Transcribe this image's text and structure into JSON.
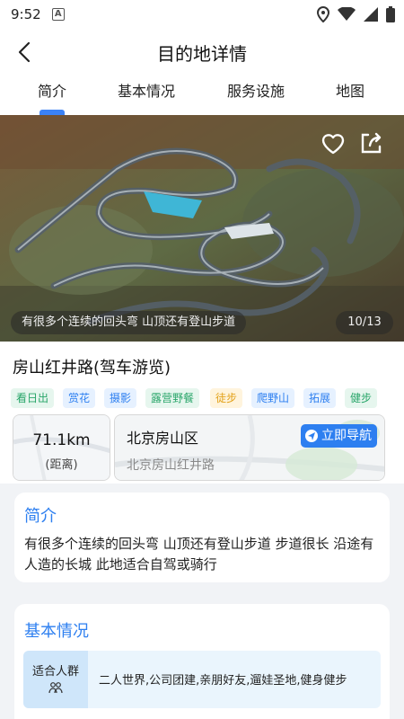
{
  "status_bar": {
    "time": "9:52",
    "badge": "A"
  },
  "header": {
    "title": "目的地详情"
  },
  "tabs": [
    {
      "label": "简介",
      "active": true
    },
    {
      "label": "基本情况",
      "active": false
    },
    {
      "label": "服务设施",
      "active": false
    },
    {
      "label": "地图",
      "active": false
    }
  ],
  "hero": {
    "caption": "有很多个连续的回头弯 山顶还有登山步道",
    "counter": "10/13",
    "icons": [
      "heart-outline-icon",
      "share-icon"
    ]
  },
  "place": {
    "name": "房山红井路(驾车游览)"
  },
  "tags": [
    {
      "label": "看日出",
      "color": "green"
    },
    {
      "label": "赏花",
      "color": "blue"
    },
    {
      "label": "摄影",
      "color": "blue"
    },
    {
      "label": "露营野餐",
      "color": "green"
    },
    {
      "label": "徒步",
      "color": "orange"
    },
    {
      "label": "爬野山",
      "color": "blue"
    },
    {
      "label": "拓展",
      "color": "blue"
    },
    {
      "label": "健步",
      "color": "green"
    }
  ],
  "distance": {
    "value": "71.1km",
    "label": "(距离)"
  },
  "location": {
    "city": "北京房山区",
    "address": "北京房山红井路",
    "navigate_label": "立即导航"
  },
  "intro": {
    "title": "简介",
    "text": "有很多个连续的回头弯 山顶还有登山步道 步道很长 沿途有人造的长城 此地适合自驾或骑行"
  },
  "basic": {
    "title": "基本情况",
    "rows": [
      {
        "label": "适合人群",
        "value": "二人世界,公司团建,亲朋好友,遛娃圣地,健身健步"
      }
    ]
  },
  "colors": {
    "accent": "#2d7ff0",
    "tab_indicator": "#3b82f6",
    "section_bg": "#f1f3f6"
  }
}
